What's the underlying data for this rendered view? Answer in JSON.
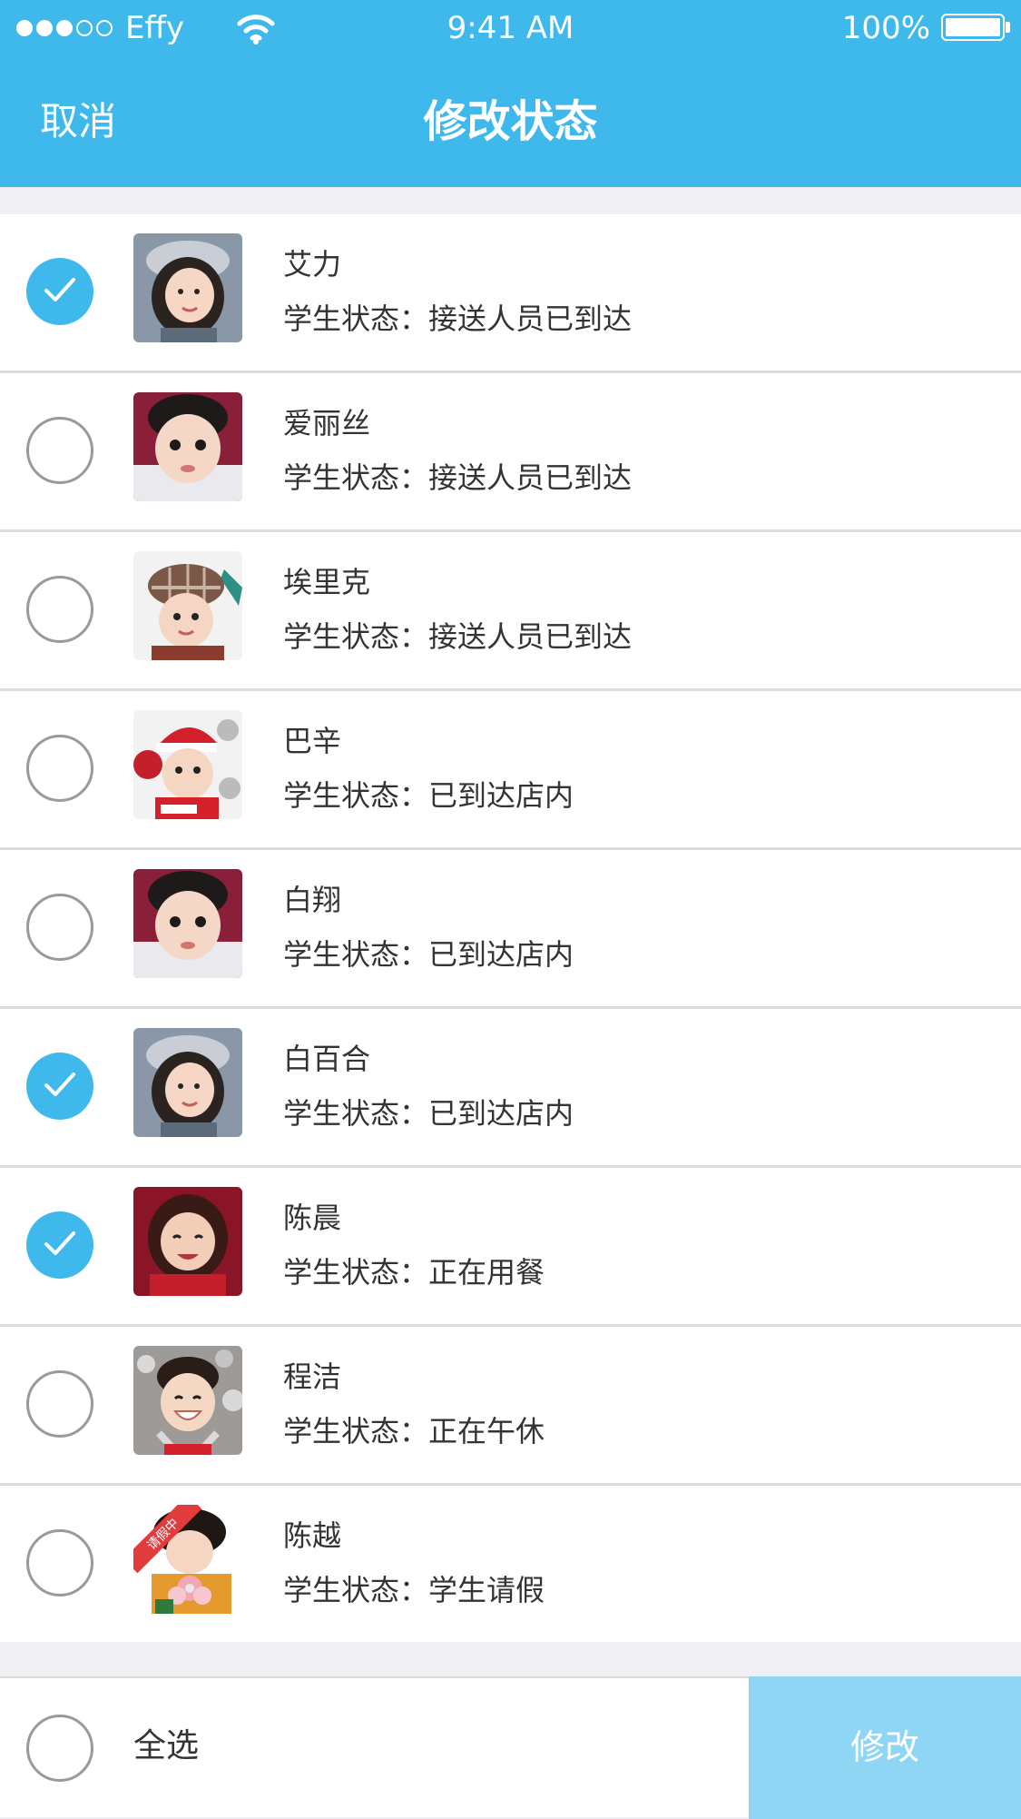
{
  "status_bar": {
    "carrier": "Effy",
    "time": "9:41 AM",
    "battery": "100%",
    "signal_icon": "signal-dots-icon",
    "wifi_icon": "wifi-icon",
    "battery_icon": "battery-icon"
  },
  "nav": {
    "cancel_label": "取消",
    "title": "修改状态"
  },
  "colors": {
    "accent": "#3fb8ec",
    "button_disabled": "#8fd6f5",
    "background": "#efeff4"
  },
  "students": [
    {
      "name": "艾力",
      "status": "学生状态：接送人员已到达",
      "checked": true,
      "avatar": "avatar-girl-gray-hat"
    },
    {
      "name": "爱丽丝",
      "status": "学生状态：接送人员已到达",
      "checked": false,
      "avatar": "avatar-boy"
    },
    {
      "name": "埃里克",
      "status": "学生状态：接送人员已到达",
      "checked": false,
      "avatar": "avatar-plaid-hat"
    },
    {
      "name": "巴辛",
      "status": "学生状态：已到达店内",
      "checked": false,
      "avatar": "avatar-santa-hat"
    },
    {
      "name": "白翔",
      "status": "学生状态：已到达店内",
      "checked": false,
      "avatar": "avatar-boy"
    },
    {
      "name": "白百合",
      "status": "学生状态：已到达店内",
      "checked": true,
      "avatar": "avatar-girl-gray-hat"
    },
    {
      "name": "陈晨",
      "status": "学生状态：正在用餐",
      "checked": true,
      "avatar": "avatar-girl-red"
    },
    {
      "name": "程洁",
      "status": "学生状态：正在午休",
      "checked": false,
      "avatar": "avatar-girl-smile"
    },
    {
      "name": "陈越",
      "status": "学生状态：学生请假",
      "checked": false,
      "avatar": "avatar-girl-flowers",
      "badge": "请假中"
    }
  ],
  "footer": {
    "select_all_label": "全选",
    "select_all_checked": false,
    "modify_label": "修改"
  }
}
